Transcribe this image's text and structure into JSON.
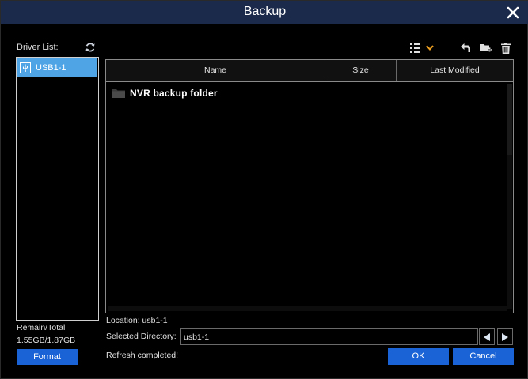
{
  "window": {
    "title": "Backup"
  },
  "drivers": {
    "label": "Driver List:",
    "items": [
      {
        "label": "USB1-1"
      }
    ]
  },
  "storage": {
    "label": "Remain/Total",
    "value": "1.55GB/1.87GB",
    "format_label": "Format"
  },
  "table": {
    "columns": [
      "Name",
      "Size",
      "Last Modified"
    ],
    "rows": [
      {
        "name": "NVR backup folder",
        "size": "",
        "modified": ""
      }
    ]
  },
  "location": {
    "text": "Location: usb1-1"
  },
  "selected_directory": {
    "label": "Selected Directory:",
    "value": "usb1-1"
  },
  "status": {
    "text": "Refresh completed!"
  },
  "buttons": {
    "ok": "OK",
    "cancel": "Cancel"
  },
  "icons": {
    "close": "close-icon",
    "refresh": "refresh-icon",
    "view": "list-view-icon",
    "back": "back-icon",
    "new_folder": "new-folder-icon",
    "delete": "delete-icon"
  },
  "colors": {
    "titlebar": "#1b2a4a",
    "selected": "#4fa4e6",
    "button": "#1a63d6",
    "accent": "#f0a020"
  }
}
